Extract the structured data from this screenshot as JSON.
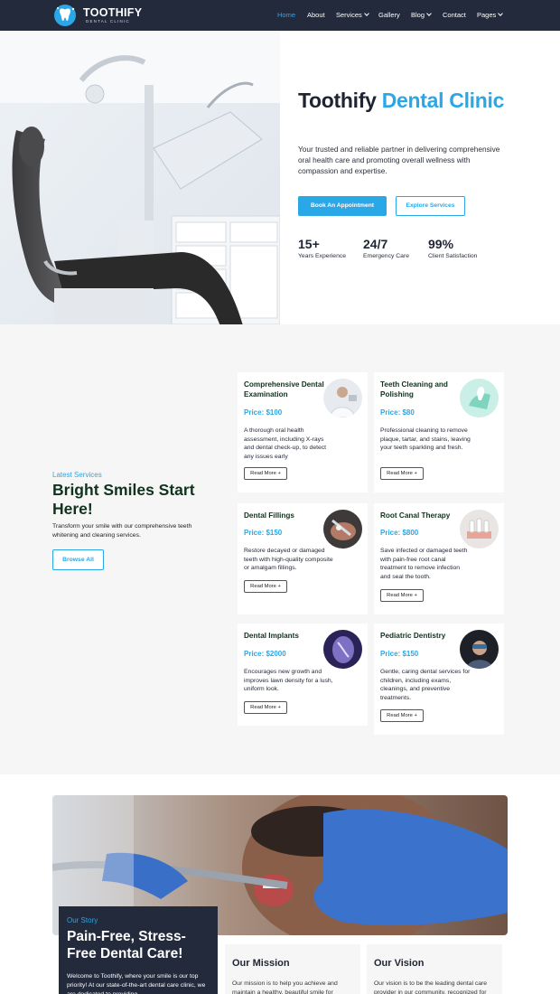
{
  "brand": {
    "name": "TOOTHIFY",
    "tagline": "DENTAL CLINIC"
  },
  "nav": {
    "items": [
      {
        "label": "Home",
        "active": true,
        "dropdown": false
      },
      {
        "label": "About",
        "active": false,
        "dropdown": false
      },
      {
        "label": "Services",
        "active": false,
        "dropdown": true
      },
      {
        "label": "Gallery",
        "active": false,
        "dropdown": false
      },
      {
        "label": "Blog",
        "active": false,
        "dropdown": true
      },
      {
        "label": "Contact",
        "active": false,
        "dropdown": false
      },
      {
        "label": "Pages",
        "active": false,
        "dropdown": true
      }
    ]
  },
  "hero": {
    "title_dark": "Toothify ",
    "title_blue": "Dental Clinic",
    "description": "Your trusted and reliable partner in delivering comprehensive oral health care and promoting overall wellness with compassion and expertise.",
    "primary_button": "Book An Appointment",
    "secondary_button": "Explore Services",
    "stats": [
      {
        "value": "15+",
        "label": "Years Experience"
      },
      {
        "value": "24/7",
        "label": "Emergency Care"
      },
      {
        "value": "99%",
        "label": "Client Satisfaction"
      }
    ]
  },
  "services": {
    "kicker": "Latest Services",
    "title": "Bright Smiles Start Here!",
    "description": "Transform your smile with our comprehensive teeth whitening and cleaning services.",
    "browse_button": "Browse All",
    "read_more": "Read More +",
    "cards": [
      {
        "title": "Comprehensive Dental Examination",
        "price": "Price: $100",
        "description": "A thorough oral health assessment, including X-rays and dental check-up, to detect any issues early"
      },
      {
        "title": "Teeth Cleaning and Polishing",
        "price": "Price: $80",
        "description": "Professional cleaning to remove plaque, tartar, and stains, leaving your teeth sparkling and fresh."
      },
      {
        "title": "Dental Fillings",
        "price": "Price: $150",
        "description": "Restore decayed or damaged teeth with high-quality composite or amalgam fillings."
      },
      {
        "title": "Root Canal Therapy",
        "price": "Price: $800",
        "description": "Save infected or damaged teeth with pain-free root canal treatment to remove infection and seal the tooth."
      },
      {
        "title": "Dental Implants",
        "price": "Price: $2000",
        "description": "Encourages new growth and improves lawn density for a lush, uniform look."
      },
      {
        "title": "Pediatric Dentistry",
        "price": "Price: $150",
        "description": "Gentle, caring dental services for children, including exams, cleanings, and preventive treatments."
      }
    ]
  },
  "story": {
    "kicker": "Our Story",
    "title": "Pain-Free, Stress-Free Dental Care!",
    "text": "Welcome to Toothify, where your smile is our top priority! At our state-of-the-art dental care clinic, we are dedicated to providing"
  },
  "mission": {
    "title": "Our Mission",
    "text": "Our mission is to help you achieve and maintain a healthy, beautiful smile for"
  },
  "vision": {
    "title": "Our Vision",
    "text": "Our vision is to be the leading dental care provider in our community, recognized for"
  },
  "colors": {
    "accent": "#2aa7e6",
    "navy": "#222a3b",
    "heading_green": "#10331d",
    "section_bg": "#f6f6f6"
  }
}
